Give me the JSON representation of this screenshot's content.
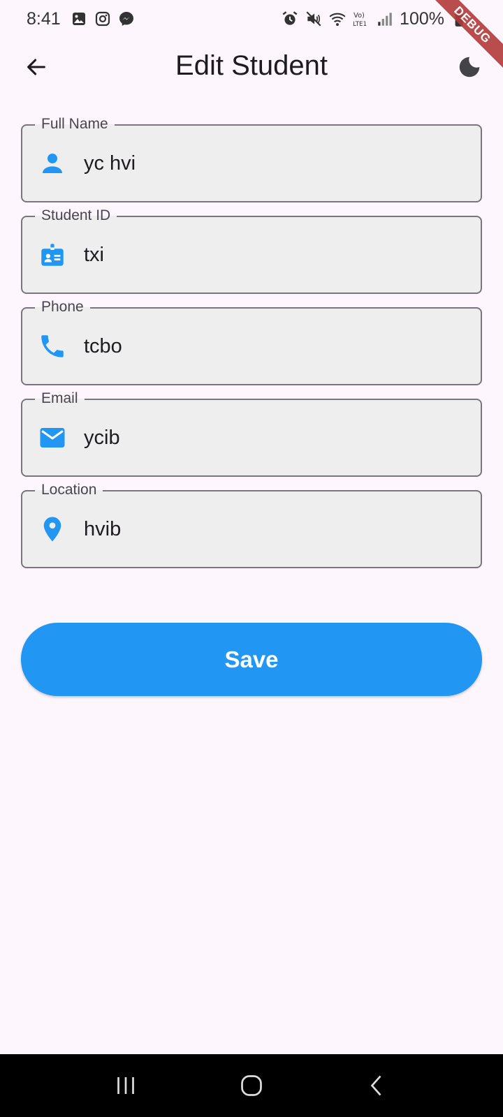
{
  "status_bar": {
    "time": "8:41",
    "battery": "100%",
    "left_icons": [
      "gallery-icon",
      "instagram-icon",
      "messenger-icon"
    ],
    "right_icons": [
      "alarm-icon",
      "mute-icon",
      "wifi-icon",
      "volte-icon",
      "signal-icon",
      "battery-icon"
    ]
  },
  "debug_banner": "DEBUG",
  "app_bar": {
    "title": "Edit Student",
    "back_icon": "arrow-back-icon",
    "theme_icon": "dark-mode-moon-icon"
  },
  "form": {
    "fields": [
      {
        "label": "Full Name",
        "value": "yc hvi",
        "icon": "person-icon"
      },
      {
        "label": "Student ID",
        "value": "txi",
        "icon": "badge-icon"
      },
      {
        "label": "Phone",
        "value": "tcbo",
        "icon": "phone-icon"
      },
      {
        "label": "Email",
        "value": "ycib",
        "icon": "email-icon"
      },
      {
        "label": "Location",
        "value": "hvib",
        "icon": "location-pin-icon"
      }
    ],
    "save_label": "Save"
  },
  "nav_bar": {
    "buttons": [
      "recent-apps-icon",
      "home-icon",
      "back-nav-icon"
    ]
  },
  "colors": {
    "background": "#FDF7FD",
    "accent": "#2196F3",
    "field_fill": "#EEEEEE",
    "field_border": "#79747E",
    "debug_ribbon": "#B23A3A"
  }
}
